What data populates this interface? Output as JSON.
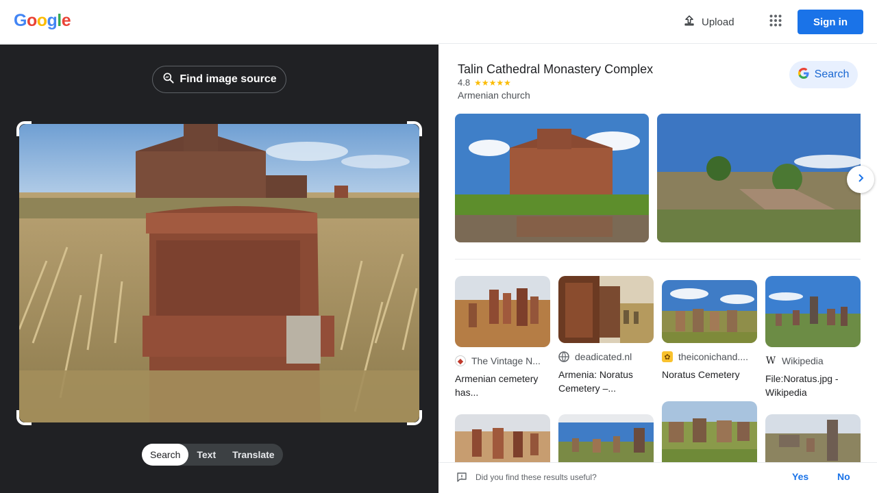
{
  "header": {
    "logo_letters": [
      {
        "char": "G",
        "color": "#4285f4"
      },
      {
        "char": "o",
        "color": "#ea4335"
      },
      {
        "char": "o",
        "color": "#fbbc05"
      },
      {
        "char": "g",
        "color": "#4285f4"
      },
      {
        "char": "l",
        "color": "#34a853"
      },
      {
        "char": "e",
        "color": "#ea4335"
      }
    ],
    "upload_label": "Upload",
    "upload_icon": "upload-icon",
    "apps_icon": "apps-grid-icon",
    "signin_label": "Sign in",
    "signin_color": "#1a73e8"
  },
  "left": {
    "find_source_label": "Find image source",
    "find_source_icon": "image-search-icon",
    "mode_tabs": [
      {
        "label": "Search",
        "active": true
      },
      {
        "label": "Text",
        "active": false
      },
      {
        "label": "Translate",
        "active": false
      }
    ]
  },
  "knowledge_panel": {
    "title": "Talin Cathedral Monastery Complex",
    "rating": "4.8",
    "stars": "★★★★★",
    "subtitle": "Armenian church",
    "search_label": "Search",
    "search_icon": "google-g-icon",
    "next_icon": "chevron-right-icon"
  },
  "results": [
    {
      "source": "The Vintage N...",
      "title": "Armenian cemetery has...",
      "favicon": "vintage-news-favicon"
    },
    {
      "source": "deadicated.nl",
      "title": "Armenia: Noratus Cemetery –...",
      "favicon": "globe-icon"
    },
    {
      "source": "theiconichand....",
      "title": "Noratus Cemetery",
      "favicon": "iconic-hand-favicon"
    },
    {
      "source": "Wikipedia",
      "title": "File:Noratus.jpg - Wikipedia",
      "favicon": "wikipedia-icon"
    }
  ],
  "feedback": {
    "question": "Did you find these results useful?",
    "yes_label": "Yes",
    "no_label": "No",
    "icon": "feedback-icon"
  }
}
